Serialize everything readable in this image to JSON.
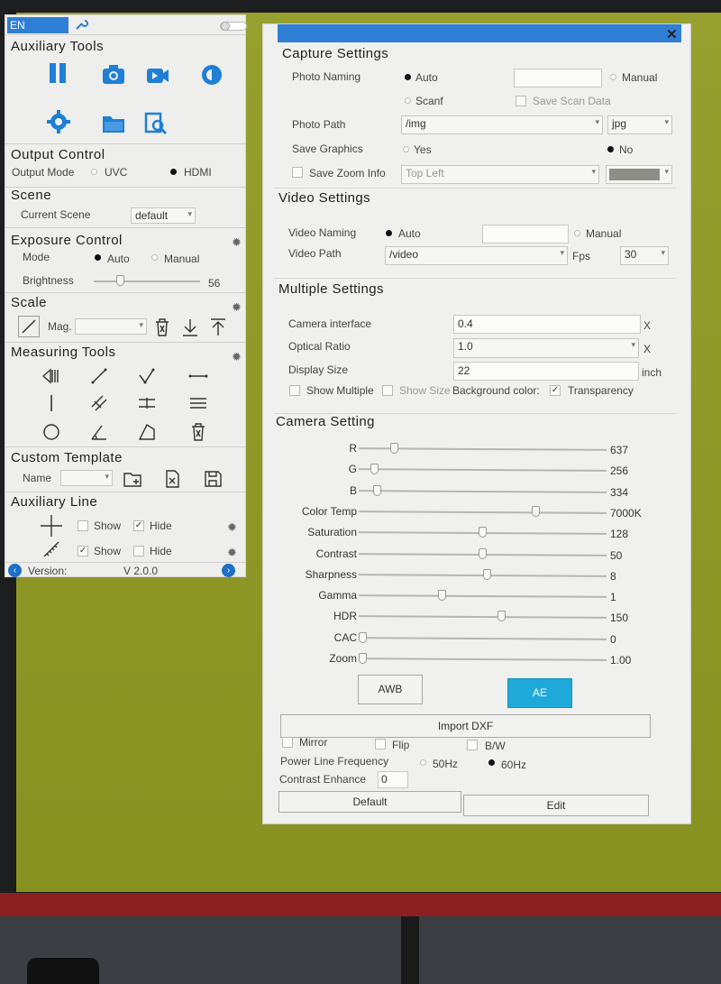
{
  "left_panel": {
    "language": "EN",
    "auxiliary_tools": {
      "title": "Auxiliary Tools"
    },
    "output_control": {
      "title": "Output Control",
      "mode_label": "Output Mode",
      "opt_uvc": "UVC",
      "opt_hdmi": "HDMI",
      "selected": "HDMI"
    },
    "scene": {
      "title": "Scene",
      "label": "Current Scene",
      "value": "default"
    },
    "exposure": {
      "title": "Exposure Control",
      "mode_label": "Mode",
      "opt_auto": "Auto",
      "opt_manual": "Manual",
      "selected": "Auto",
      "brightness_label": "Brightness",
      "brightness_value": "56"
    },
    "scale": {
      "title": "Scale",
      "mag_label": "Mag."
    },
    "measuring_tools": {
      "title": "Measuring Tools"
    },
    "custom_template": {
      "title": "Custom Template",
      "name_label": "Name"
    },
    "auxiliary_line": {
      "title": "Auxiliary Line",
      "show1": "Show",
      "hide1": "Hide",
      "show2": "Show",
      "hide2": "Hide"
    },
    "footer": {
      "version_label": "Version:",
      "version_value": "V 2.0.0"
    }
  },
  "settings_panel": {
    "capture": {
      "title": "Capture Settings",
      "photo_naming_label": "Photo Naming",
      "opt_auto": "Auto",
      "opt_manual": "Manual",
      "opt_scanf": "Scanf",
      "save_scan_data": "Save Scan Data",
      "photo_path_label": "Photo Path",
      "photo_path": "/img",
      "photo_format": "jpg",
      "save_graphics_label": "Save Graphics",
      "opt_yes": "Yes",
      "opt_no": "No",
      "save_zoom_info": "Save Zoom Info",
      "zoom_position": "Top Left"
    },
    "video": {
      "title": "Video Settings",
      "naming_label": "Video Naming",
      "opt_auto": "Auto",
      "opt_manual": "Manual",
      "path_label": "Video Path",
      "path": "/video",
      "fps_label": "Fps",
      "fps": "30"
    },
    "multiple": {
      "title": "Multiple Settings",
      "camera_interface_label": "Camera interface",
      "camera_interface": "0.4",
      "optical_ratio_label": "Optical Ratio",
      "optical_ratio": "1.0",
      "display_size_label": "Display Size",
      "display_size": "22",
      "unit_x": "X",
      "unit_x2": "X",
      "unit_inch": "inch",
      "show_multiple": "Show Multiple",
      "show_size": "Show Size",
      "background_color": "Background color:",
      "transparency": "Transparency"
    },
    "camera": {
      "title": "Camera Setting",
      "sliders": [
        {
          "label": "R",
          "value": "637",
          "level": 0.13
        },
        {
          "label": "G",
          "value": "256",
          "level": 0.05
        },
        {
          "label": "B",
          "value": "334",
          "level": 0.06
        },
        {
          "label": "Color Temp",
          "value": "7000K",
          "level": 0.72
        },
        {
          "label": "Saturation",
          "value": "128",
          "level": 0.5
        },
        {
          "label": "Contrast",
          "value": "50",
          "level": 0.5
        },
        {
          "label": "Sharpness",
          "value": "8",
          "level": 0.52
        },
        {
          "label": "Gamma",
          "value": "1",
          "level": 0.33
        },
        {
          "label": "HDR",
          "value": "150",
          "level": 0.58
        },
        {
          "label": "CAC",
          "value": "0",
          "level": 0.0
        },
        {
          "label": "Zoom",
          "value": "1.00",
          "level": 0.0
        }
      ],
      "awb": "AWB",
      "ae": "AE",
      "import_dxf": "Import DXF",
      "mirror": "Mirror",
      "flip": "Flip",
      "bw": "B/W",
      "power_line_label": "Power Line Frequency",
      "opt_50": "50Hz",
      "opt_60": "60Hz",
      "contrast_enhance_label": "Contrast Enhance",
      "contrast_enhance": "0",
      "default": "Default",
      "edit": "Edit"
    }
  }
}
